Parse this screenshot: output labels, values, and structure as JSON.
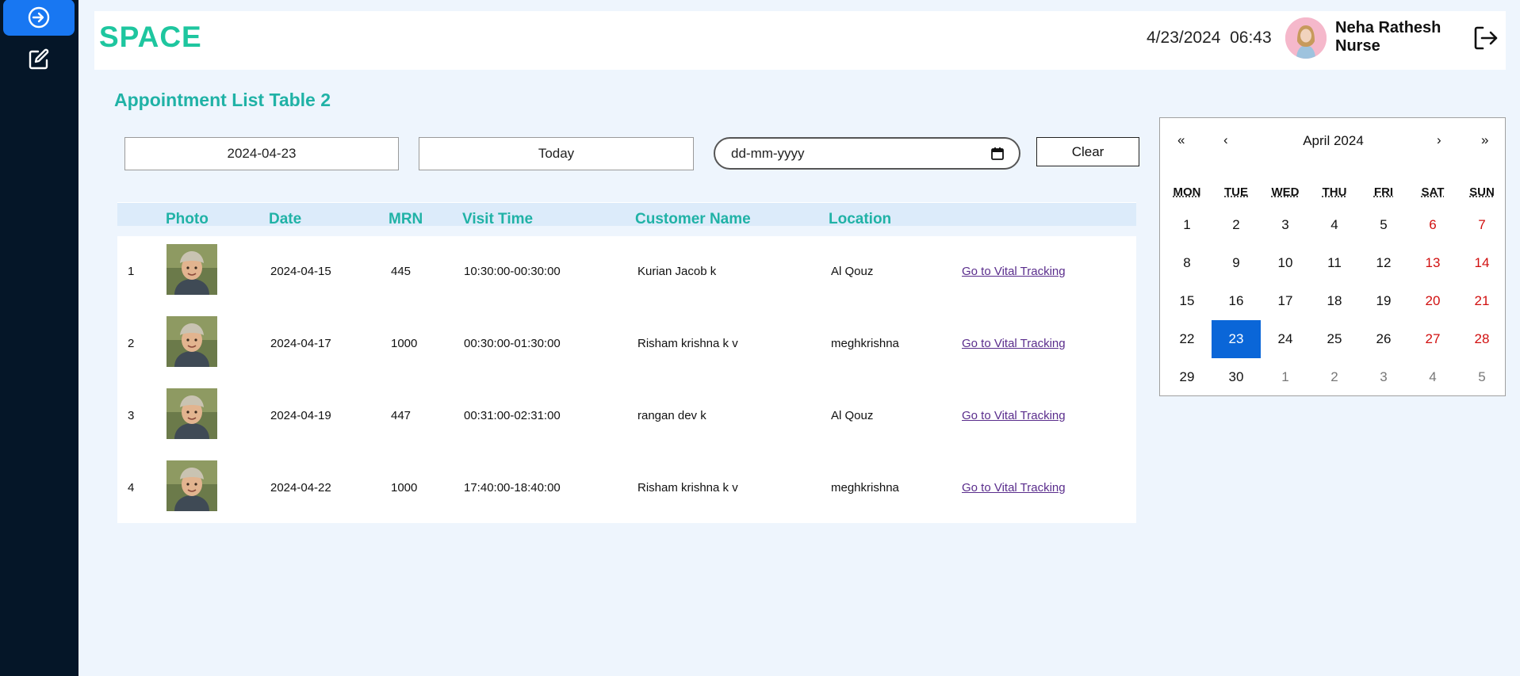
{
  "sidebar": {
    "items": [
      {
        "icon": "login-icon"
      },
      {
        "icon": "edit-icon"
      }
    ]
  },
  "header": {
    "logo_text": "SPACE",
    "datetime": "4/23/2024  06:43",
    "user_name": "Neha Rathesh",
    "user_role": "Nurse"
  },
  "page": {
    "title": "Appointment List Table 2"
  },
  "filters": {
    "date_value": "2024-04-23",
    "today_label": "Today",
    "date_placeholder": "dd-mm-yyyy",
    "clear_label": "Clear"
  },
  "table": {
    "columns": [
      "Photo",
      "Date",
      "MRN",
      "Visit Time",
      "Customer Name",
      "Location"
    ],
    "rows": [
      {
        "index": "1",
        "date": "2024-04-15",
        "mrn": "445",
        "visit_time": "10:30:00-00:30:00",
        "customer": "Kurian Jacob k",
        "location": "Al Qouz",
        "action": "Go to Vital Tracking"
      },
      {
        "index": "2",
        "date": "2024-04-17",
        "mrn": "1000",
        "visit_time": "00:30:00-01:30:00",
        "customer": "Risham krishna k v",
        "location": "meghkrishna",
        "action": "Go to Vital Tracking"
      },
      {
        "index": "3",
        "date": "2024-04-19",
        "mrn": "447",
        "visit_time": "00:31:00-02:31:00",
        "customer": "rangan dev k",
        "location": "Al Qouz",
        "action": "Go to Vital Tracking"
      },
      {
        "index": "4",
        "date": "2024-04-22",
        "mrn": "1000",
        "visit_time": "17:40:00-18:40:00",
        "customer": "Risham krishna k v",
        "location": "meghkrishna",
        "action": "Go to Vital Tracking"
      }
    ]
  },
  "calendar": {
    "month_label": "April 2024",
    "prev_year": "«",
    "prev_month": "‹",
    "next_month": "›",
    "next_year": "»",
    "weekdays": [
      "MON",
      "TUE",
      "WED",
      "THU",
      "FRI",
      "SAT",
      "SUN"
    ],
    "weeks": [
      [
        "1",
        "2",
        "3",
        "4",
        "5",
        "6",
        "7"
      ],
      [
        "8",
        "9",
        "10",
        "11",
        "12",
        "13",
        "14"
      ],
      [
        "15",
        "16",
        "17",
        "18",
        "19",
        "20",
        "21"
      ],
      [
        "22",
        "23",
        "24",
        "25",
        "26",
        "27",
        "28"
      ],
      [
        "29",
        "30",
        "1",
        "2",
        "3",
        "4",
        "5"
      ]
    ],
    "selected": "23",
    "colors": {
      "selected": "#0a66d8",
      "weekend": "#d10f0f",
      "accent": "#20b2a6"
    }
  }
}
